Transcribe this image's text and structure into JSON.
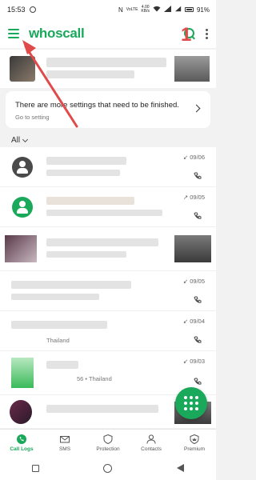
{
  "status_bar": {
    "time": "15:53",
    "net_top": "4.00",
    "net_bottom": "KB/s",
    "net_type": "VoLTE",
    "battery": "91%"
  },
  "header": {
    "app_name": "whoscall",
    "annotation": "1"
  },
  "settings_card": {
    "title": "There are more settings that need to be finished.",
    "link": "Go to setting"
  },
  "filter": {
    "label": "All"
  },
  "calls": [
    {
      "date": "↙ 09/06",
      "sub": ""
    },
    {
      "date": "↗ 09/05",
      "sub": ""
    },
    {
      "date": "↙ 09/05",
      "sub": ""
    },
    {
      "date": "↙ 09/04",
      "sub": "Thailand"
    },
    {
      "date": "↙ 09/03",
      "sub": "56 • Thailand"
    }
  ],
  "bottom_nav": [
    {
      "label": "Call Logs",
      "icon": "phone-circle-icon"
    },
    {
      "label": "SMS",
      "icon": "envelope-icon"
    },
    {
      "label": "Protection",
      "icon": "shield-icon"
    },
    {
      "label": "Contacts",
      "icon": "person-icon"
    },
    {
      "label": "Premium",
      "icon": "premium-shield-icon"
    }
  ],
  "colors": {
    "accent": "#1aa85a",
    "annotation": "#e14a4a"
  }
}
